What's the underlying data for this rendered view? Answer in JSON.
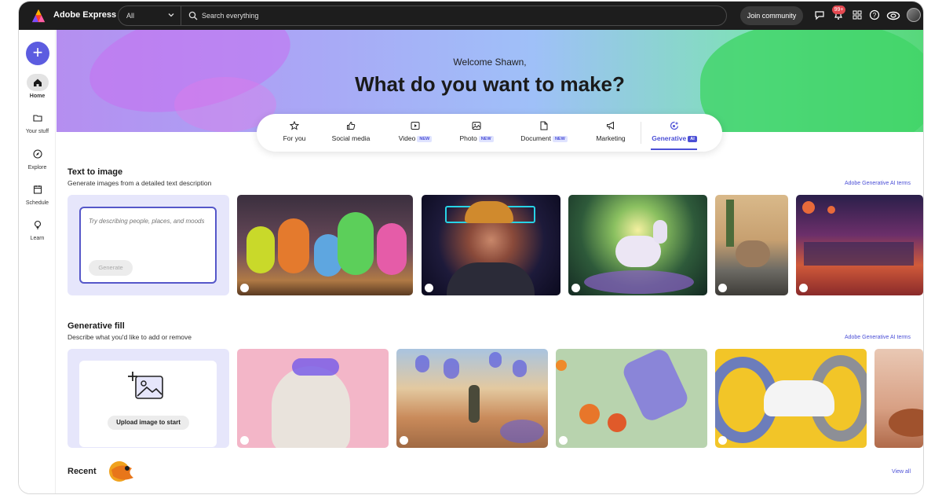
{
  "topbar": {
    "app_title": "Adobe Express",
    "scope_value": "All",
    "search_placeholder": "Search everything",
    "join_label": "Join community",
    "notification_count": "99+",
    "icons": [
      "chat-icon",
      "bell-icon",
      "apps-grid-icon",
      "help-icon",
      "creative-cloud-icon",
      "avatar"
    ]
  },
  "rail": {
    "create_label": "+",
    "items": [
      {
        "label": "Home",
        "icon": "home-icon"
      },
      {
        "label": "Your stuff",
        "icon": "folder-icon"
      },
      {
        "label": "Explore",
        "icon": "compass-icon"
      },
      {
        "label": "Schedule",
        "icon": "calendar-icon"
      },
      {
        "label": "Learn",
        "icon": "lightbulb-icon"
      }
    ]
  },
  "hero": {
    "welcome": "Welcome Shawn,",
    "headline": "What do you want to make?"
  },
  "tabs": [
    {
      "label": "For you",
      "tag": ""
    },
    {
      "label": "Social media",
      "tag": ""
    },
    {
      "label": "Video",
      "tag": "NEW"
    },
    {
      "label": "Photo",
      "tag": "NEW"
    },
    {
      "label": "Document",
      "tag": "NEW"
    },
    {
      "label": "Marketing",
      "tag": ""
    },
    {
      "label": "Generative",
      "tag": "AI"
    }
  ],
  "text_to_image": {
    "title": "Text to image",
    "subtitle": "Generate images from a detailed text description",
    "terms": "Adobe Generative AI terms",
    "prompt_placeholder": "Try describing people, places, and moods",
    "generate_label": "Generate"
  },
  "generative_fill": {
    "title": "Generative fill",
    "subtitle": "Describe what you'd like to add or remove",
    "terms": "Adobe Generative AI terms",
    "upload_label": "Upload image to start"
  },
  "recent": {
    "title": "Recent",
    "view_all": "View all"
  }
}
